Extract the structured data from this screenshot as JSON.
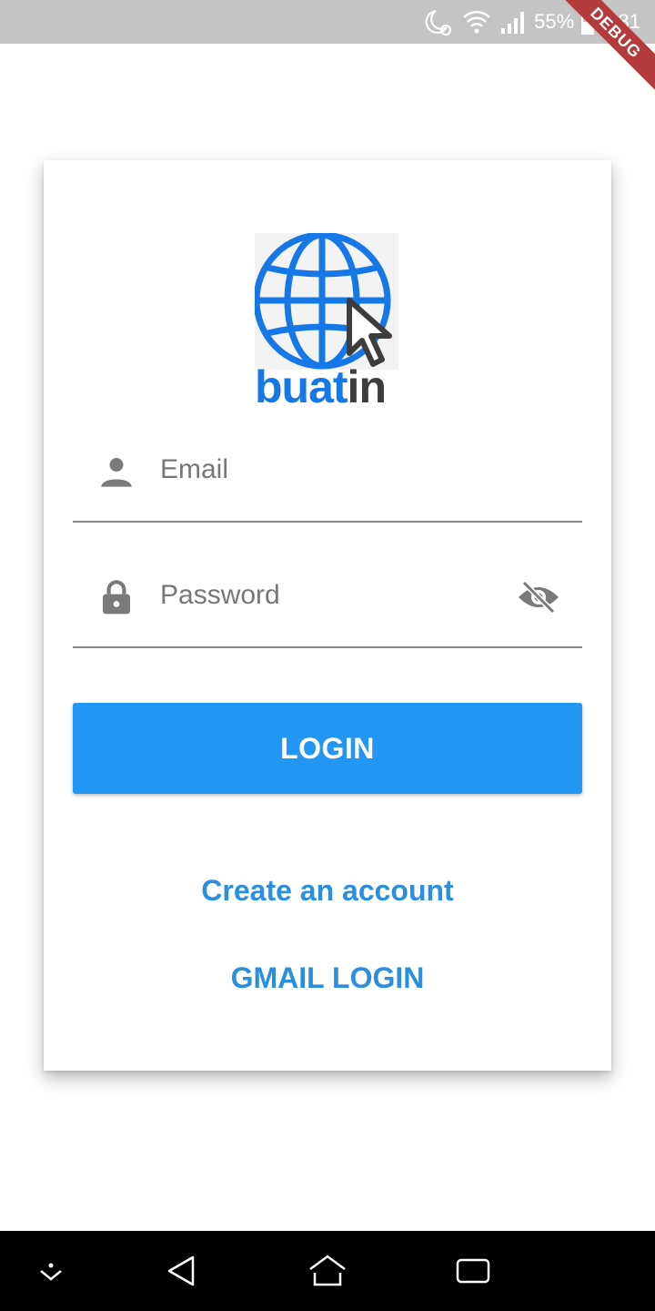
{
  "status_bar": {
    "battery": "55%",
    "time": "8:31"
  },
  "debug_banner": "DEBUG",
  "logo": {
    "text_blue": "buat",
    "text_dark": "in"
  },
  "form": {
    "email_placeholder": "Email",
    "password_placeholder": "Password"
  },
  "buttons": {
    "login": "LOGIN",
    "create_account": "Create an account",
    "gmail_login": "GMAIL LOGIN"
  },
  "colors": {
    "primary": "#2196f3",
    "link": "#2a8fdf",
    "logo_blue": "#1677e6",
    "status_bar": "#c4c4c4"
  },
  "icons": {
    "email": "person-icon",
    "password": "lock-icon",
    "visibility": "visibility-off-icon"
  }
}
